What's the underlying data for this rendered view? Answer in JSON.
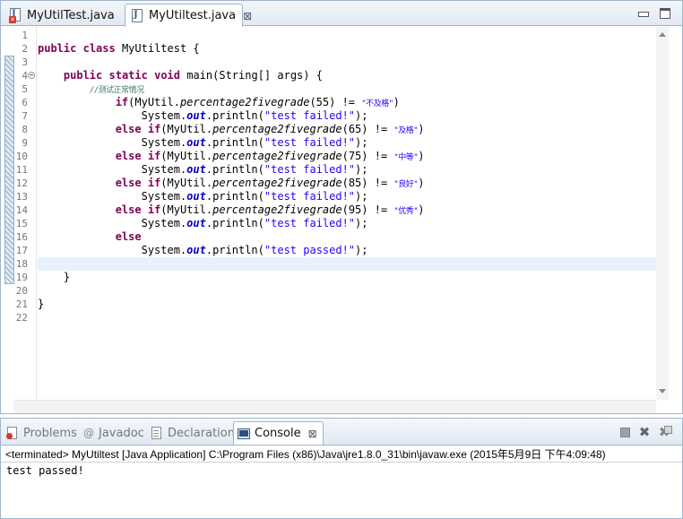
{
  "editor": {
    "tabs": [
      {
        "label": "MyUtilTest.java",
        "active": false,
        "error": true
      },
      {
        "label": "MyUtiltest.java",
        "active": true,
        "close": "⊠"
      }
    ],
    "line_numbers": [
      "1",
      "2",
      "3",
      "4",
      "5",
      "6",
      "7",
      "8",
      "9",
      "10",
      "11",
      "12",
      "13",
      "14",
      "15",
      "16",
      "17",
      "18",
      "19",
      "20",
      "21",
      "22"
    ],
    "current_line": 18,
    "code": [
      "",
      "public class MyUtiltest {",
      "",
      "    public static void main(String[] args) {",
      "        //测试正常情况",
      "            if(MyUtil.percentage2fivegrade(55) != \"不及格\")",
      "                System.out.println(\"test failed!\");",
      "            else if(MyUtil.percentage2fivegrade(65) != \"及格\")",
      "                System.out.println(\"test failed!\");",
      "            else if(MyUtil.percentage2fivegrade(75) != \"中等\")",
      "                System.out.println(\"test failed!\");",
      "            else if(MyUtil.percentage2fivegrade(85) != \"良好\")",
      "                System.out.println(\"test failed!\");",
      "            else if(MyUtil.percentage2fivegrade(95) != \"优秀\")",
      "                System.out.println(\"test failed!\");",
      "            else",
      "                System.out.println(\"test passed!\");",
      "",
      "    }",
      "",
      "}",
      ""
    ],
    "colors": {
      "keyword": "#7f0055",
      "string": "#2a00ff",
      "comment": "#3f7f5f",
      "field": "#0000c0",
      "current_line_bg": "#e8f2fe"
    }
  },
  "console_view": {
    "tabs": [
      {
        "label": "Problems",
        "icon": "problems-icon",
        "active": false
      },
      {
        "label": "Javadoc",
        "icon": "javadoc-icon",
        "active": false,
        "glyph": "@"
      },
      {
        "label": "Declaration",
        "icon": "declaration-icon",
        "active": false
      },
      {
        "label": "Console",
        "icon": "console-icon",
        "active": true,
        "close": "⊠"
      }
    ],
    "toolbar": {
      "remove_launch_glyph": "✖",
      "remove_all_glyph": "✖"
    },
    "status_line": "<terminated> MyUtiltest [Java Application] C:\\Program Files (x86)\\Java\\jre1.8.0_31\\bin\\javaw.exe (2015年5月9日 下午4:09:48)",
    "output": "test passed!"
  }
}
